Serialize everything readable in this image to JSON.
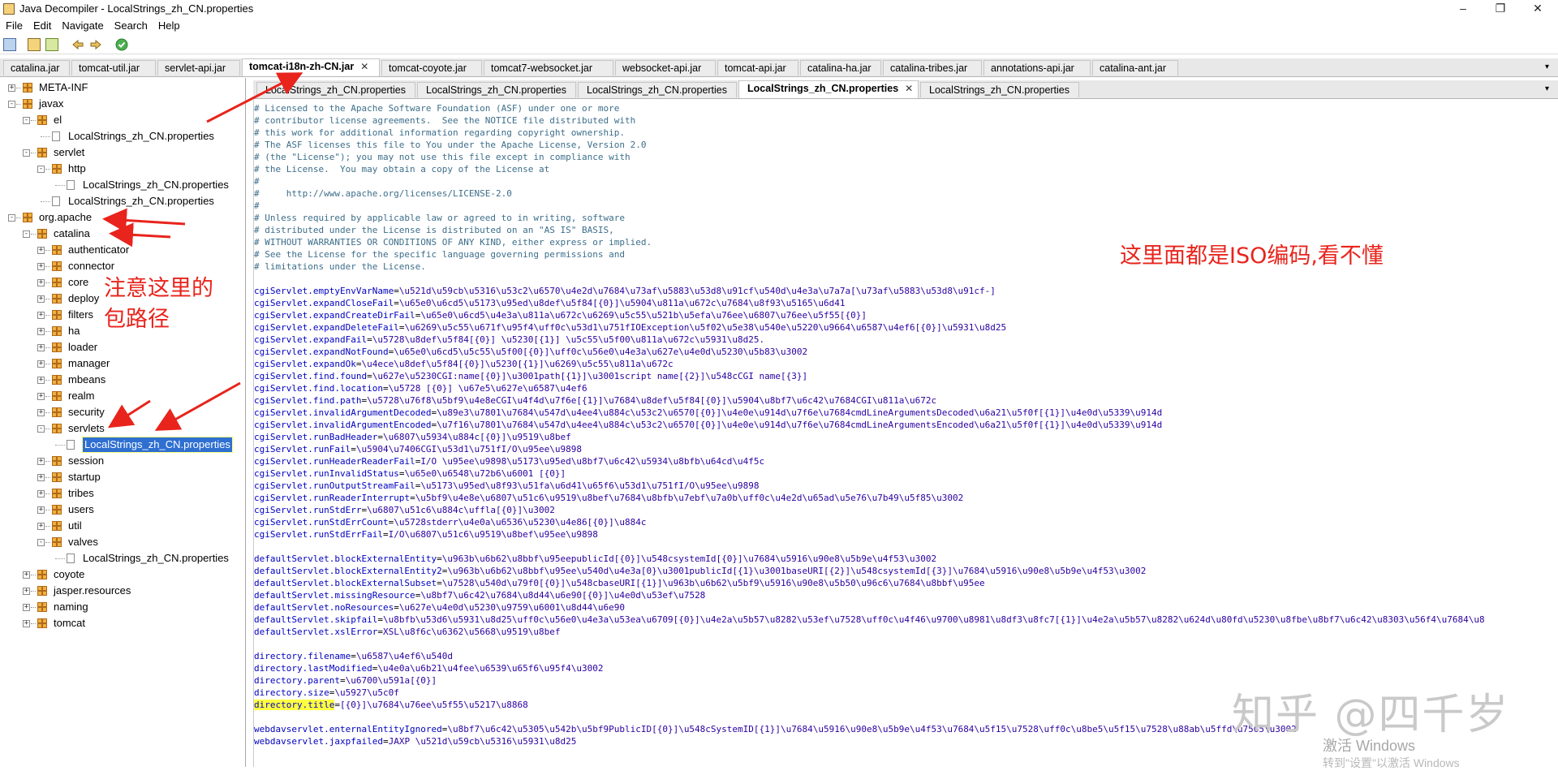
{
  "window": {
    "title": "Java Decompiler - LocalStrings_zh_CN.properties",
    "minimize": "–",
    "restore": "❐",
    "close": "✕"
  },
  "menu": [
    "File",
    "Edit",
    "Navigate",
    "Search",
    "Help"
  ],
  "jar_tabs": [
    "catalina.jar",
    "tomcat-util.jar",
    "servlet-api.jar",
    "tomcat-i18n-zh-CN.jar",
    "tomcat-coyote.jar",
    "tomcat7-websocket.jar",
    "websocket-api.jar",
    "tomcat-api.jar",
    "catalina-ha.jar",
    "catalina-tribes.jar",
    "annotations-api.jar",
    "catalina-ant.jar"
  ],
  "tree": [
    {
      "label": "META-INF",
      "kind": "pkg",
      "exp": "+"
    },
    {
      "label": "javax",
      "kind": "pkg",
      "exp": "-"
    },
    {
      "label": "el",
      "kind": "pkg",
      "exp": "-"
    },
    {
      "label": "LocalStrings_zh_CN.properties",
      "kind": "file",
      "exp": ""
    },
    {
      "label": "servlet",
      "kind": "pkg",
      "exp": "-"
    },
    {
      "label": "http",
      "kind": "pkg",
      "exp": "-"
    },
    {
      "label": "LocalStrings_zh_CN.properties",
      "kind": "file",
      "exp": ""
    },
    {
      "label": "LocalStrings_zh_CN.properties",
      "kind": "file",
      "exp": ""
    },
    {
      "label": "org.apache",
      "kind": "pkg",
      "exp": "-"
    },
    {
      "label": "catalina",
      "kind": "pkg",
      "exp": "-"
    },
    {
      "label": "authenticator",
      "kind": "pkg",
      "exp": "+"
    },
    {
      "label": "connector",
      "kind": "pkg",
      "exp": "+"
    },
    {
      "label": "core",
      "kind": "pkg",
      "exp": "+"
    },
    {
      "label": "deploy",
      "kind": "pkg",
      "exp": "+"
    },
    {
      "label": "filters",
      "kind": "pkg",
      "exp": "+"
    },
    {
      "label": "ha",
      "kind": "pkg",
      "exp": "+"
    },
    {
      "label": "loader",
      "kind": "pkg",
      "exp": "+"
    },
    {
      "label": "manager",
      "kind": "pkg",
      "exp": "+"
    },
    {
      "label": "mbeans",
      "kind": "pkg",
      "exp": "+"
    },
    {
      "label": "realm",
      "kind": "pkg",
      "exp": "+"
    },
    {
      "label": "security",
      "kind": "pkg",
      "exp": "+"
    },
    {
      "label": "servlets",
      "kind": "pkg",
      "exp": "-"
    },
    {
      "label": "LocalStrings_zh_CN.properties",
      "kind": "file",
      "exp": "",
      "selected": true
    },
    {
      "label": "session",
      "kind": "pkg",
      "exp": "+"
    },
    {
      "label": "startup",
      "kind": "pkg",
      "exp": "+"
    },
    {
      "label": "tribes",
      "kind": "pkg",
      "exp": "+"
    },
    {
      "label": "users",
      "kind": "pkg",
      "exp": "+"
    },
    {
      "label": "util",
      "kind": "pkg",
      "exp": "+"
    },
    {
      "label": "valves",
      "kind": "pkg",
      "exp": "-"
    },
    {
      "label": "LocalStrings_zh_CN.properties",
      "kind": "file",
      "exp": ""
    },
    {
      "label": "coyote",
      "kind": "pkg",
      "exp": "+"
    },
    {
      "label": "jasper.resources",
      "kind": "pkg",
      "exp": "+"
    },
    {
      "label": "naming",
      "kind": "pkg",
      "exp": "+"
    },
    {
      "label": "tomcat",
      "kind": "pkg",
      "exp": "+"
    }
  ],
  "file_tabs": [
    "LocalStrings_zh_CN.properties",
    "LocalStrings_zh_CN.properties",
    "LocalStrings_zh_CN.properties",
    "LocalStrings_zh_CN.properties",
    "LocalStrings_zh_CN.properties"
  ],
  "code": [
    {
      "t": "c",
      "s": "# Licensed to the Apache Software Foundation (ASF) under one or more"
    },
    {
      "t": "c",
      "s": "# contributor license agreements.  See the NOTICE file distributed with"
    },
    {
      "t": "c",
      "s": "# this work for additional information regarding copyright ownership."
    },
    {
      "t": "c",
      "s": "# The ASF licenses this file to You under the Apache License, Version 2.0"
    },
    {
      "t": "c",
      "s": "# (the \"License\"); you may not use this file except in compliance with"
    },
    {
      "t": "c",
      "s": "# the License.  You may obtain a copy of the License at"
    },
    {
      "t": "c",
      "s": "#"
    },
    {
      "t": "c",
      "s": "#     http://www.apache.org/licenses/LICENSE-2.0"
    },
    {
      "t": "c",
      "s": "#"
    },
    {
      "t": "c",
      "s": "# Unless required by applicable law or agreed to in writing, software"
    },
    {
      "t": "c",
      "s": "# distributed under the License is distributed on an \"AS IS\" BASIS,"
    },
    {
      "t": "c",
      "s": "# WITHOUT WARRANTIES OR CONDITIONS OF ANY KIND, either express or implied."
    },
    {
      "t": "c",
      "s": "# See the License for the specific language governing permissions and"
    },
    {
      "t": "c",
      "s": "# limitations under the License."
    },
    {
      "t": "b",
      "s": ""
    },
    {
      "t": "p",
      "k": "cgiServlet.emptyEnvVarName",
      "v": "\\u521d\\u59cb\\u5316\\u53c2\\u6570\\u4e2d\\u7684\\u73af\\u5883\\u53d8\\u91cf\\u540d\\u4e3a\\u7a7a[\\u73af\\u5883\\u53d8\\u91cf-]"
    },
    {
      "t": "p",
      "k": "cgiServlet.expandCloseFail",
      "v": "\\u65e0\\u6cd5\\u5173\\u95ed\\u8def\\u5f84[{0}]\\u5904\\u811a\\u672c\\u7684\\u8f93\\u5165\\u6d41"
    },
    {
      "t": "p",
      "k": "cgiServlet.expandCreateDirFail",
      "v": "\\u65e0\\u6cd5\\u4e3a\\u811a\\u672c\\u6269\\u5c55\\u521b\\u5efa\\u76ee\\u6807\\u76ee\\u5f55[{0}]"
    },
    {
      "t": "p",
      "k": "cgiServlet.expandDeleteFail",
      "v": "\\u6269\\u5c55\\u671f\\u95f4\\uff0c\\u53d1\\u751fIOException\\u5f02\\u5e38\\u540e\\u5220\\u9664\\u6587\\u4ef6[{0}]\\u5931\\u8d25"
    },
    {
      "t": "p",
      "k": "cgiServlet.expandFail",
      "v": "\\u5728\\u8def\\u5f84[{0}] \\u5230[{1}] \\u5c55\\u5f00\\u811a\\u672c\\u5931\\u8d25."
    },
    {
      "t": "p",
      "k": "cgiServlet.expandNotFound",
      "v": "\\u65e0\\u6cd5\\u5c55\\u5f00[{0}]\\uff0c\\u56e0\\u4e3a\\u627e\\u4e0d\\u5230\\u5b83\\u3002"
    },
    {
      "t": "p",
      "k": "cgiServlet.expandOk",
      "v": "\\u4ece\\u8def\\u5f84[{0}]\\u5230[{1}]\\u6269\\u5c55\\u811a\\u672c"
    },
    {
      "t": "p",
      "k": "cgiServlet.find.found",
      "v": "\\u627e\\u5230CGI:name[{0}]\\u3001path[{1}]\\u3001script name[{2}]\\u548cCGI name[{3}]"
    },
    {
      "t": "p",
      "k": "cgiServlet.find.location",
      "v": "\\u5728 [{0}] \\u67e5\\u627e\\u6587\\u4ef6"
    },
    {
      "t": "p",
      "k": "cgiServlet.find.path",
      "v": "\\u5728\\u76f8\\u5bf9\\u4e8eCGI\\u4f4d\\u7f6e[{1}]\\u7684\\u8def\\u5f84[{0}]\\u5904\\u8bf7\\u6c42\\u7684CGI\\u811a\\u672c"
    },
    {
      "t": "p",
      "k": "cgiServlet.invalidArgumentDecoded",
      "v": "\\u89e3\\u7801\\u7684\\u547d\\u4ee4\\u884c\\u53c2\\u6570[{0}]\\u4e0e\\u914d\\u7f6e\\u7684cmdLineArgumentsDecoded\\u6a21\\u5f0f[{1}]\\u4e0d\\u5339\\u914d"
    },
    {
      "t": "p",
      "k": "cgiServlet.invalidArgumentEncoded",
      "v": "\\u7f16\\u7801\\u7684\\u547d\\u4ee4\\u884c\\u53c2\\u6570[{0}]\\u4e0e\\u914d\\u7f6e\\u7684cmdLineArgumentsEncoded\\u6a21\\u5f0f[{1}]\\u4e0d\\u5339\\u914d"
    },
    {
      "t": "p",
      "k": "cgiServlet.runBadHeader",
      "v": "\\u6807\\u5934\\u884c[{0}]\\u9519\\u8bef"
    },
    {
      "t": "p",
      "k": "cgiServlet.runFail",
      "v": "\\u5904\\u7406CGI\\u53d1\\u751fI/O\\u95ee\\u9898"
    },
    {
      "t": "p",
      "k": "cgiServlet.runHeaderReaderFail",
      "v": "I/O \\u95ee\\u9898\\u5173\\u95ed\\u8bf7\\u6c42\\u5934\\u8bfb\\u64cd\\u4f5c"
    },
    {
      "t": "p",
      "k": "cgiServlet.runInvalidStatus",
      "v": "\\u65e0\\u6548\\u72b6\\u6001 [{0}]"
    },
    {
      "t": "p",
      "k": "cgiServlet.runOutputStreamFail",
      "v": "\\u5173\\u95ed\\u8f93\\u51fa\\u6d41\\u65f6\\u53d1\\u751fI/O\\u95ee\\u9898"
    },
    {
      "t": "p",
      "k": "cgiServlet.runReaderInterrupt",
      "v": "\\u5bf9\\u4e8e\\u6807\\u51c6\\u9519\\u8bef\\u7684\\u8bfb\\u7ebf\\u7a0b\\uff0c\\u4e2d\\u65ad\\u5e76\\u7b49\\u5f85\\u3002"
    },
    {
      "t": "p",
      "k": "cgiServlet.runStdErr",
      "v": "\\u6807\\u51c6\\u884c\\uffla[{0}]\\u3002"
    },
    {
      "t": "p",
      "k": "cgiServlet.runStdErrCount",
      "v": "\\u5728stderr\\u4e0a\\u6536\\u5230\\u4e86[{0}]\\u884c"
    },
    {
      "t": "p",
      "k": "cgiServlet.runStdErrFail",
      "v": "I/O\\u6807\\u51c6\\u9519\\u8bef\\u95ee\\u9898"
    },
    {
      "t": "b",
      "s": ""
    },
    {
      "t": "p",
      "k": "defaultServlet.blockExternalEntity",
      "v": "\\u963b\\u6b62\\u8bbf\\u95eepublicId[{0}]\\u548csystemId[{0}]\\u7684\\u5916\\u90e8\\u5b9e\\u4f53\\u3002"
    },
    {
      "t": "p",
      "k": "defaultServlet.blockExternalEntity2",
      "v": "\\u963b\\u6b62\\u8bbf\\u95ee\\u540d\\u4e3a[0}\\u3001publicId[{1}\\u3001baseURI[{2}]\\u548csystemId[{3}]\\u7684\\u5916\\u90e8\\u5b9e\\u4f53\\u3002"
    },
    {
      "t": "p",
      "k": "defaultServlet.blockExternalSubset",
      "v": "\\u7528\\u540d\\u79f0[{0}]\\u548cbaseURI[{1}]\\u963b\\u6b62\\u5bf9\\u5916\\u90e8\\u5b50\\u96c6\\u7684\\u8bbf\\u95ee"
    },
    {
      "t": "p",
      "k": "defaultServlet.missingResource",
      "v": "\\u8bf7\\u6c42\\u7684\\u8d44\\u6e90[{0}]\\u4e0d\\u53ef\\u7528"
    },
    {
      "t": "p",
      "k": "defaultServlet.noResources",
      "v": "\\u627e\\u4e0d\\u5230\\u9759\\u6001\\u8d44\\u6e90"
    },
    {
      "t": "p",
      "k": "defaultServlet.skipfail",
      "v": "\\u8bfb\\u53d6\\u5931\\u8d25\\uff0c\\u56e0\\u4e3a\\u53ea\\u6709[{0}]\\u4e2a\\u5b57\\u8282\\u53ef\\u7528\\uff0c\\u4f46\\u9700\\u8981\\u8df3\\u8fc7[{1}]\\u4e2a\\u5b57\\u8282\\u624d\\u80fd\\u5230\\u8fbe\\u8bf7\\u6c42\\u8303\\u56f4\\u7684\\u8"
    },
    {
      "t": "p",
      "k": "defaultServlet.xslError",
      "v": "XSL\\u8f6c\\u6362\\u5668\\u9519\\u8bef"
    },
    {
      "t": "b",
      "s": ""
    },
    {
      "t": "p",
      "k": "directory.filename",
      "v": "\\u6587\\u4ef6\\u540d"
    },
    {
      "t": "p",
      "k": "directory.lastModified",
      "v": "\\u4e0a\\u6b21\\u4fee\\u6539\\u65f6\\u95f4\\u3002"
    },
    {
      "t": "p",
      "k": "directory.parent",
      "v": "\\u6700\\u591a[{0}]"
    },
    {
      "t": "p",
      "k": "directory.size",
      "v": "\\u5927\\u5c0f"
    },
    {
      "t": "p",
      "k": "directory.title",
      "v": "[{0}]\\u7684\\u76ee\\u5f55\\u5217\\u8868",
      "hl": true
    },
    {
      "t": "b",
      "s": ""
    },
    {
      "t": "p",
      "k": "webdavservlet.enternalEntityIgnored",
      "v": "\\u8bf7\\u6c42\\u5305\\u542b\\u5bf9PublicID[{0}]\\u548cSystemID[{1}]\\u7684\\u5916\\u90e8\\u5b9e\\u4f53\\u7684\\u5f15\\u7528\\uff0c\\u8be5\\u5f15\\u7528\\u88ab\\u5ffd\\u7565\\u3002"
    },
    {
      "t": "p",
      "k": "webdavservlet.jaxpfailed",
      "v": "JAXP \\u521d\\u59cb\\u5316\\u5931\\u8d25"
    }
  ],
  "annotations": {
    "package_path": [
      "注意这里的",
      "包路径"
    ],
    "encoding_note": "这里面都是ISO编码,看不懂"
  },
  "watermark": "知乎 @四千岁",
  "windows_activation": {
    "line1": "激活 Windows",
    "line2": "转到\"设置\"以激活 Windows"
  },
  "colors": {
    "annotation_red": "#e8241c",
    "selection_blue": "#2e6fd1",
    "highlight_yellow": "#ffff40",
    "comment": "#3d6e8a",
    "key": "#0000c0"
  }
}
